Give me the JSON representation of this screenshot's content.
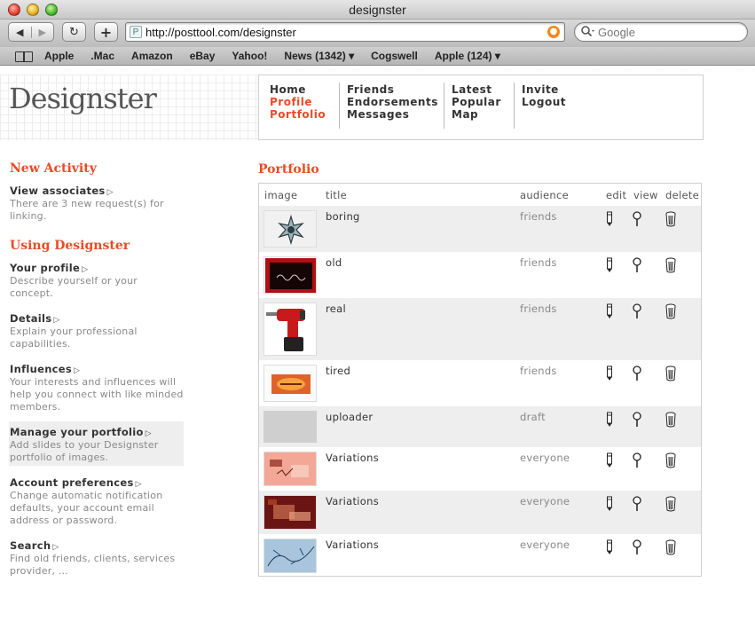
{
  "window": {
    "title": "designster"
  },
  "toolbar": {
    "back_glyph": "◀",
    "forward_glyph": "▶",
    "reload_glyph": "↻",
    "newtab_glyph": "+",
    "url": "http://posttool.com/designster",
    "search_placeholder": "Google"
  },
  "bookmarks": [
    "Apple",
    ".Mac",
    "Amazon",
    "eBay",
    "Yahoo!",
    "News (1342) ▾",
    "Cogswell",
    "Apple (124) ▾"
  ],
  "site": {
    "logo": "Designster",
    "nav": {
      "col1": [
        "Home",
        "Profile",
        "Portfolio"
      ],
      "col2": [
        "Friends",
        "Endorsements",
        "Messages"
      ],
      "col3": [
        "Latest",
        "Popular",
        "Map"
      ],
      "col4": [
        "Invite",
        "Logout"
      ]
    },
    "accent_color": "#e94b27"
  },
  "sidebar": {
    "new_activity_heading": "New Activity",
    "view_associates": {
      "label": "View associates",
      "desc": "There are 3 new request(s) for linking."
    },
    "using_heading": "Using Designster",
    "items": [
      {
        "label": "Your profile",
        "desc": "Describe yourself or your concept."
      },
      {
        "label": "Details",
        "desc": "Explain your professional capabilities."
      },
      {
        "label": "Influences",
        "desc": "Your interests and influences will help you connect with like minded members."
      },
      {
        "label": "Manage your portfolio",
        "desc": "Add slides to your Designster portfolio of images."
      },
      {
        "label": "Account preferences",
        "desc": "Change automatic notification defaults, your account email address or password."
      },
      {
        "label": "Search",
        "desc": "Find old friends, clients, services provider, ..."
      }
    ]
  },
  "portfolio": {
    "title": "Portfolio",
    "columns": {
      "image": "image",
      "title": "title",
      "audience": "audience",
      "edit": "edit",
      "view": "view",
      "delete": "delete"
    },
    "rows": [
      {
        "title": "boring",
        "audience": "friends",
        "thumb_icon": "star-ornament-thumbnail"
      },
      {
        "title": "old",
        "audience": "friends",
        "thumb_icon": "dark-sign-thumbnail"
      },
      {
        "title": "real",
        "audience": "friends",
        "thumb_icon": "power-drill-thumbnail"
      },
      {
        "title": "tired",
        "audience": "friends",
        "thumb_icon": "orange-pattern-thumbnail"
      },
      {
        "title": "uploader",
        "audience": "draft",
        "thumb_icon": "blank-thumbnail"
      },
      {
        "title": "Variations",
        "audience": "everyone",
        "thumb_icon": "pink-variation-thumbnail"
      },
      {
        "title": "Variations",
        "audience": "everyone",
        "thumb_icon": "red-variation-thumbnail"
      },
      {
        "title": "Variations",
        "audience": "everyone",
        "thumb_icon": "blue-variation-thumbnail"
      }
    ]
  }
}
